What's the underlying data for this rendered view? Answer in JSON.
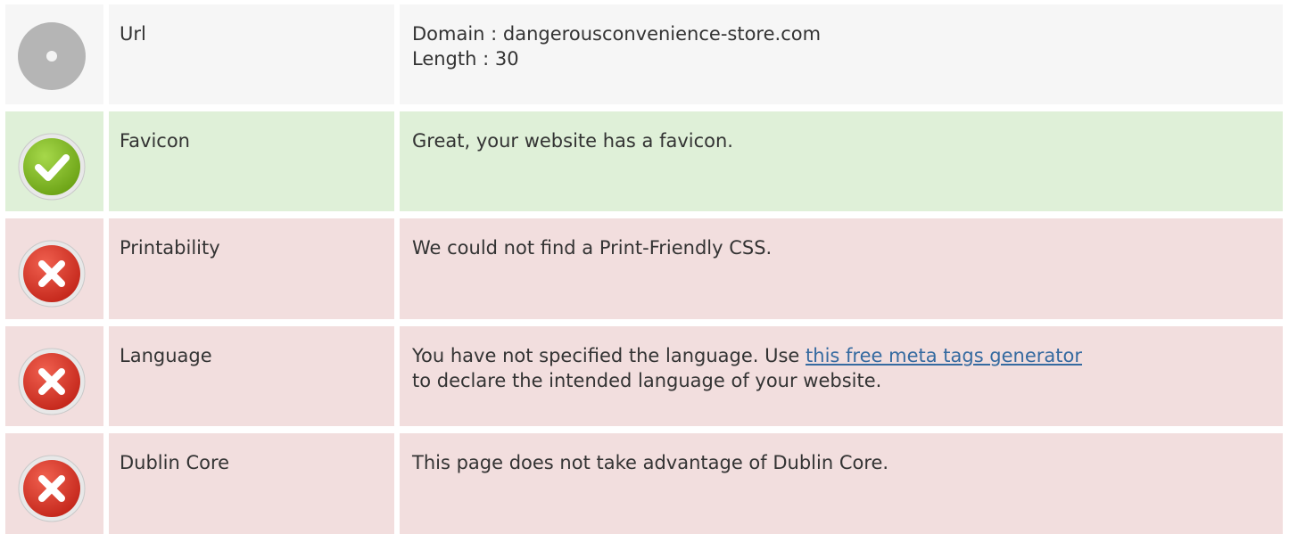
{
  "colors": {
    "neutral_bg": "#f6f6f6",
    "success_bg": "#dff0d8",
    "error_bg": "#f2dede",
    "link": "#356aa0",
    "text": "#333333"
  },
  "rows": [
    {
      "status": "neutral",
      "icon": "neutral-dot-icon",
      "label": "Url",
      "lines": [
        "Domain : dangerousconvenience-store.com",
        "Length : 30"
      ]
    },
    {
      "status": "success",
      "icon": "checkmark-icon",
      "label": "Favicon",
      "lines": [
        "Great, your website has a favicon."
      ]
    },
    {
      "status": "error",
      "icon": "error-x-icon",
      "label": "Printability",
      "lines": [
        "We could not find a Print-Friendly CSS."
      ]
    },
    {
      "status": "error",
      "icon": "error-x-icon",
      "label": "Language",
      "text_before_link": "You have not specified the language. Use ",
      "link_text": "this free meta tags generator",
      "text_after_link": "to declare the intended language of your website."
    },
    {
      "status": "error",
      "icon": "error-x-icon",
      "label": "Dublin Core",
      "lines": [
        "This page does not take advantage of Dublin Core."
      ]
    }
  ]
}
